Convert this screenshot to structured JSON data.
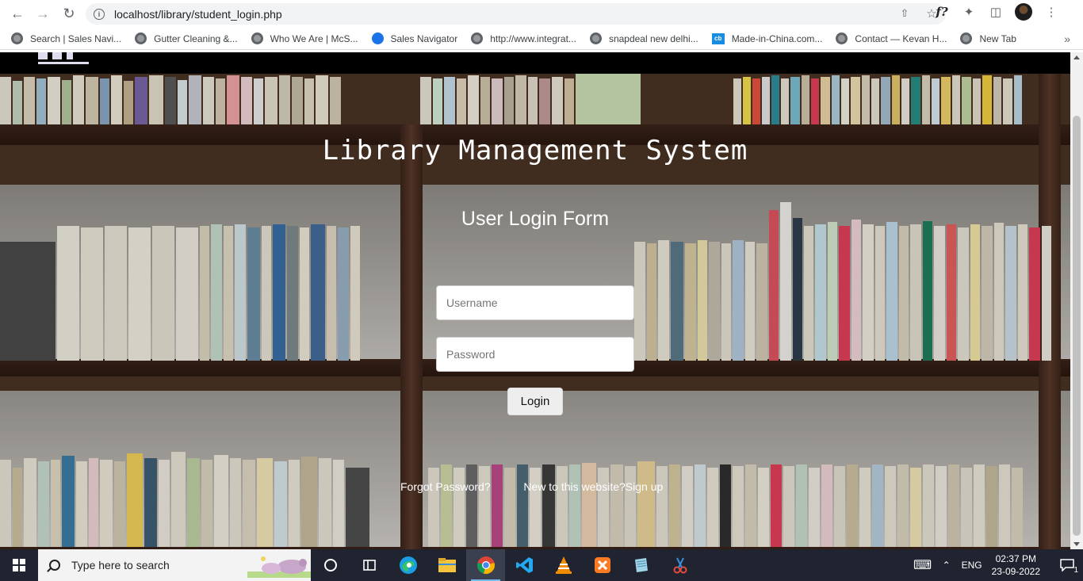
{
  "browser": {
    "url": "localhost/library/student_login.php",
    "bookmarks": [
      {
        "label": "Search | Sales Navi...",
        "icon": "globe-icon"
      },
      {
        "label": "Gutter Cleaning &...",
        "icon": "globe-icon"
      },
      {
        "label": "Who We Are | McS...",
        "icon": "globe-icon"
      },
      {
        "label": "Sales Navigator",
        "icon": "compass-icon"
      },
      {
        "label": "http://www.integrat...",
        "icon": "globe-icon"
      },
      {
        "label": "snapdeal new delhi...",
        "icon": "globe-icon"
      },
      {
        "label": "Made-in-China.com...",
        "icon": "cb-icon"
      },
      {
        "label": "Contact — Kevan H...",
        "icon": "globe-icon"
      },
      {
        "label": "New Tab",
        "icon": "globe-icon"
      }
    ],
    "extension_label": "f?"
  },
  "page": {
    "title": "Library Management System",
    "form_title": "User Login Form",
    "username_placeholder": "Username",
    "password_placeholder": "Password",
    "login_label": "Login",
    "forgot_label": "Forgot Password?",
    "new_user_label": "New to this website?",
    "signup_label": "Sign up"
  },
  "taskbar": {
    "search_placeholder": "Type here to search",
    "language": "ENG",
    "time": "02:37 PM",
    "date": "23-09-2022",
    "notification_count": "1"
  },
  "colors": {
    "taskbar_bg": "#1f2430",
    "title_text": "#ffffff"
  }
}
